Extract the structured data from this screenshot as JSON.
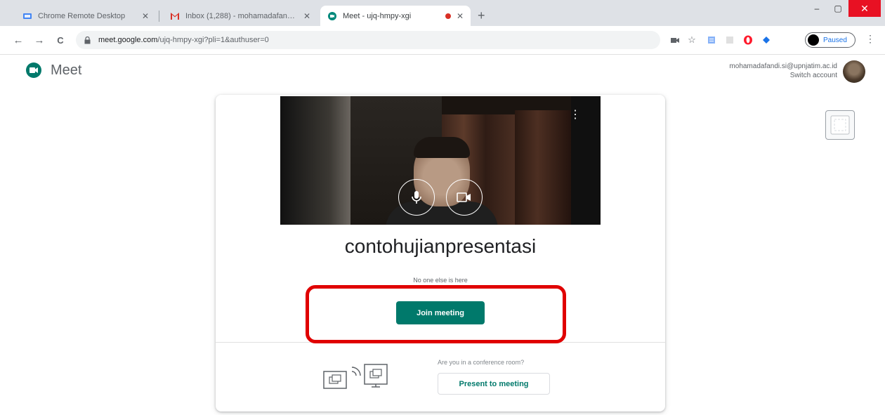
{
  "colors": {
    "accent": "#00796b",
    "highlight": "#e00000",
    "close_red": "#e81123"
  },
  "browser": {
    "tabs": [
      {
        "title": "Chrome Remote Desktop",
        "icon": "remote-desktop-icon"
      },
      {
        "title": "Inbox (1,288) - mohamadafandi...",
        "icon": "gmail-icon"
      },
      {
        "title": "Meet - ujq-hmpy-xgi",
        "icon": "meet-icon",
        "active": true
      }
    ],
    "tab_close_glyph": "✕",
    "new_tab_glyph": "+",
    "window": {
      "minimize_glyph": "–",
      "maximize_glyph": "▢",
      "close_glyph": "✕"
    },
    "nav": {
      "back_glyph": "←",
      "forward_glyph": "→",
      "reload_glyph": "C"
    },
    "url_host": "meet.google.com",
    "url_path": "/ujq-hmpy-xgi?pli=1&authuser=0",
    "profile_label": "Paused",
    "menu_glyph": "⋮"
  },
  "meet": {
    "logo_text": "Meet",
    "account_email": "mohamadafandi.si@upnjatim.ac.id",
    "switch_account": "Switch account",
    "meeting_name": "contohujianpresentasi",
    "status_text": "No one else is here",
    "join_label": "Join meeting",
    "conference_question": "Are you in a conference room?",
    "present_label": "Present to meeting",
    "preview_menu_glyph": "⋮"
  }
}
